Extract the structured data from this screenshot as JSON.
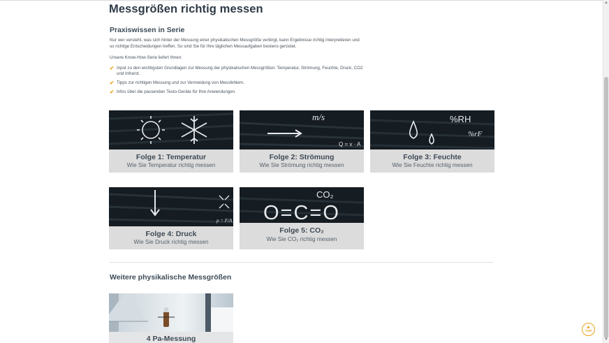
{
  "page": {
    "title": "Messgrößen richtig messen"
  },
  "intro_section": {
    "title": "Praxiswissen in Serie",
    "text": "Nur wer versteht, was sich hinter der Messung einer physikalischen Messgröße verbirgt, kann Ergebnisse richtig interpretieren und so richtige Entscheidungen treffen. So sind Sie für Ihre täglichen Messaufgaben bestens gerüstet.",
    "lead": "Unsere Know-How-Serie liefert Ihnen:",
    "bullets": [
      "Input zu den wichtigsten Grundlagen zur Messung der physikalischen Messgrößen: Temperatur, Strömung, Feuchte, Druck, CO2 und Infrarot.",
      "Tipps zur richtigen Messung und zur Vermeidung von Messfehlern.",
      "Infos über die passenden Testo-Geräte für Ihre Anwendungen."
    ],
    "check_icon": "✔"
  },
  "cards": [
    {
      "title": "Folge 1: Temperatur",
      "subtitle": "Wie Sie Temperatur richtig messen"
    },
    {
      "title": "Folge 2: Strömung",
      "subtitle": "Wie Sie Strömung richtig messen",
      "chalk_unit": "m/s",
      "chalk_formula": "Q = v · A"
    },
    {
      "title": "Folge 3: Feuchte",
      "subtitle": "Wie Sie Feuchte richtig messen",
      "chalk_rh": "%RH",
      "chalk_rf": "%rF"
    },
    {
      "title": "Folge 4: Druck",
      "subtitle": "Wie Sie Druck richtig messen",
      "chalk_formula": "p = F/A"
    },
    {
      "title": "Folge 5: CO₂",
      "subtitle": "Wie Sie CO₂ richtig messen",
      "chalk_label": "CO₂",
      "chalk_eq": "O=C=O"
    }
  ],
  "further_section": {
    "title": "Weitere physikalische Messgrößen",
    "cards": [
      {
        "title": "4 Pa-Messung"
      }
    ]
  },
  "top_button": {
    "arrow": "▲",
    "label": "TOP"
  },
  "colors": {
    "accent": "#e8a21c",
    "heading": "#2f3b47",
    "caption_bg": "#dcdcdc",
    "chalkboard": "#131a20"
  }
}
